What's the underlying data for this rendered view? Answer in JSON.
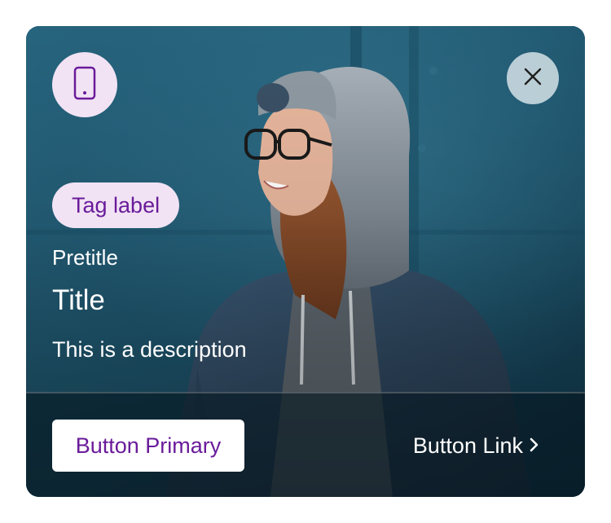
{
  "card": {
    "device_icon": "smartphone-icon",
    "close_icon": "close-icon",
    "tag_label": "Tag label",
    "pretitle": "Pretitle",
    "title": "Title",
    "description": "This is a description",
    "primary_button_label": "Button Primary",
    "link_button_label": "Button Link",
    "link_icon": "chevron-right-icon"
  },
  "colors": {
    "accent": "#6a1b9a",
    "tag_background": "#f1e3f4",
    "photo_background": "#1f5770",
    "text_on_image": "#ffffff"
  }
}
